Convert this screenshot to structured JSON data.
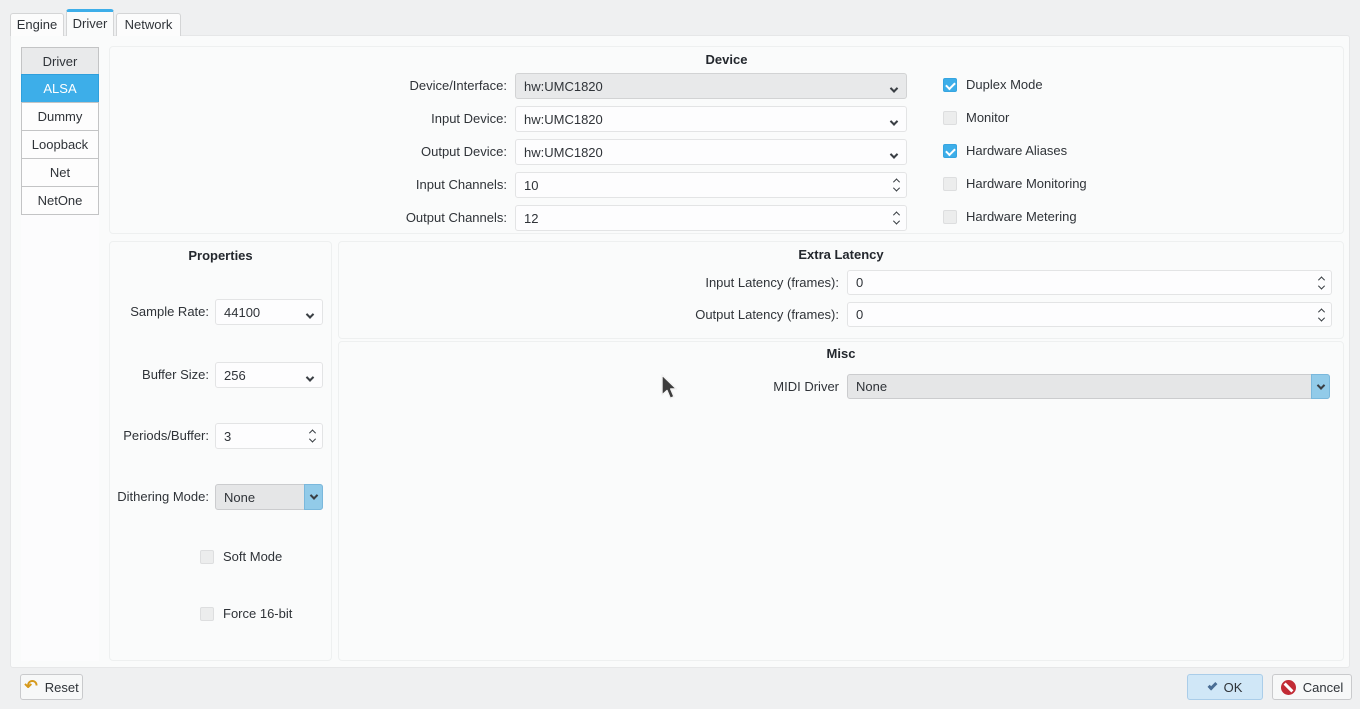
{
  "tabs": [
    {
      "label": "Engine",
      "active": false
    },
    {
      "label": "Driver",
      "active": true
    },
    {
      "label": "Network",
      "active": false
    }
  ],
  "sidebar": {
    "header": "Driver",
    "items": [
      {
        "label": "ALSA",
        "selected": true
      },
      {
        "label": "Dummy",
        "selected": false
      },
      {
        "label": "Loopback",
        "selected": false
      },
      {
        "label": "Net",
        "selected": false
      },
      {
        "label": "NetOne",
        "selected": false
      }
    ]
  },
  "device": {
    "title": "Device",
    "fields": [
      {
        "label": "Device/Interface:",
        "value": "hw:UMC1820"
      },
      {
        "label": "Input Device:",
        "value": "hw:UMC1820"
      },
      {
        "label": "Output Device:",
        "value": "hw:UMC1820"
      },
      {
        "label": "Input Channels:",
        "value": "10"
      },
      {
        "label": "Output Channels:",
        "value": "12"
      }
    ],
    "checkboxes": [
      {
        "label": "Duplex Mode",
        "checked": true
      },
      {
        "label": "Monitor",
        "checked": false
      },
      {
        "label": "Hardware Aliases",
        "checked": true
      },
      {
        "label": "Hardware Monitoring",
        "checked": false
      },
      {
        "label": "Hardware Metering",
        "checked": false
      }
    ]
  },
  "properties": {
    "title": "Properties",
    "fields": [
      {
        "label": "Sample Rate:",
        "value": "44100"
      },
      {
        "label": "Buffer Size:",
        "value": "256"
      },
      {
        "label": "Periods/Buffer:",
        "value": "3"
      },
      {
        "label": "Dithering Mode:",
        "value": "None"
      }
    ],
    "checkboxes": [
      {
        "label": "Soft Mode",
        "checked": false
      },
      {
        "label": "Force 16-bit",
        "checked": false
      }
    ]
  },
  "extra_latency": {
    "title": "Extra Latency",
    "fields": [
      {
        "label": "Input Latency (frames):",
        "value": "0"
      },
      {
        "label": "Output Latency (frames):",
        "value": "0"
      }
    ]
  },
  "misc": {
    "title": "Misc",
    "fields": [
      {
        "label": "MIDI Driver",
        "value": "None"
      }
    ]
  },
  "footer": {
    "reset_label": "Reset",
    "ok_label": "OK",
    "cancel_label": "Cancel"
  },
  "colors": {
    "accent": "#3daee9",
    "window_bg": "#eff0f1",
    "pane_bg": "#fafbfb",
    "ok_bg": "#d0e7f7",
    "cancel_icon": "#c22b35",
    "reset_icon": "#d6991b"
  }
}
